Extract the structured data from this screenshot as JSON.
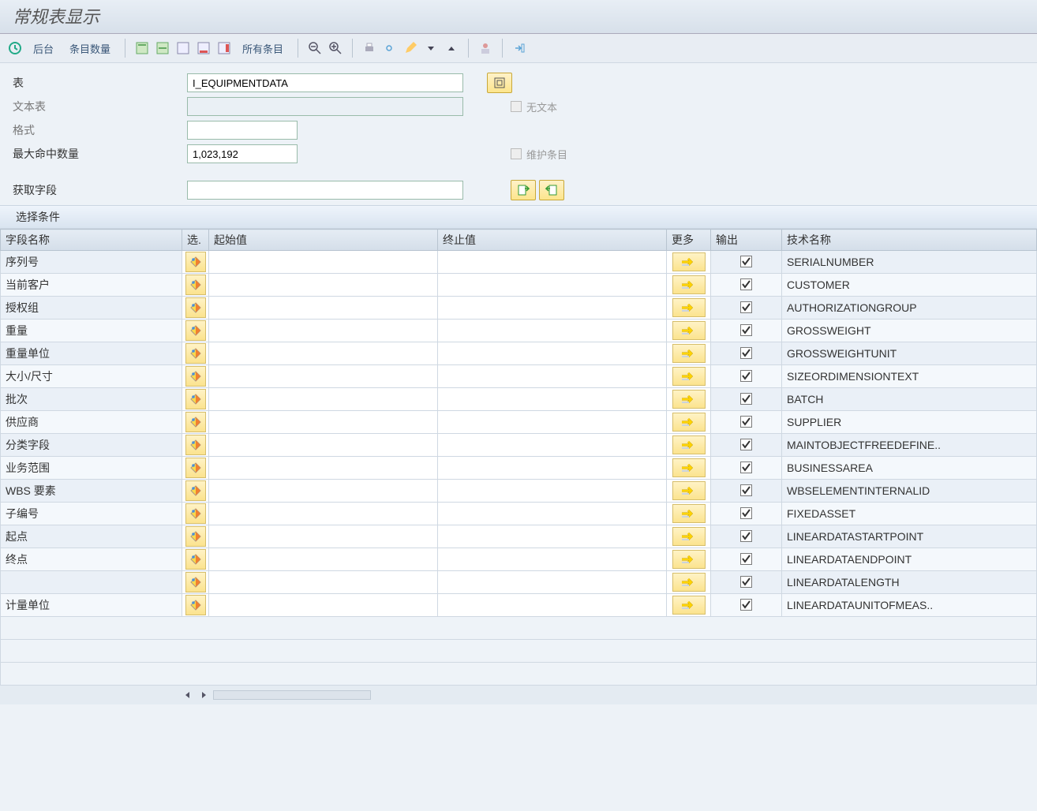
{
  "title": "常规表显示",
  "toolbar": {
    "back_label": "后台",
    "count_label": "条目数量",
    "all_label": "所有条目"
  },
  "form": {
    "table_label": "表",
    "table_value": "I_EQUIPMENTDATA",
    "text_table_label": "文本表",
    "no_text_label": "无文本",
    "format_label": "格式",
    "max_hits_label": "最大命中数量",
    "max_hits_value": "1,023,192",
    "maintain_label": "维护条目",
    "get_fields_label": "获取字段"
  },
  "section": {
    "selection_conditions": "选择条件"
  },
  "columns": {
    "field_name": "字段名称",
    "sel": "选.",
    "start_value": "起始值",
    "end_value": "终止值",
    "more": "更多",
    "output": "输出",
    "tech_name": "技术名称"
  },
  "rows": [
    {
      "label": "序列号",
      "tech": "SERIALNUMBER",
      "output": true
    },
    {
      "label": "当前客户",
      "tech": "CUSTOMER",
      "output": true
    },
    {
      "label": "授权组",
      "tech": "AUTHORIZATIONGROUP",
      "output": true
    },
    {
      "label": "重量",
      "tech": "GROSSWEIGHT",
      "output": true
    },
    {
      "label": "重量单位",
      "tech": "GROSSWEIGHTUNIT",
      "output": true
    },
    {
      "label": "大小/尺寸",
      "tech": "SIZEORDIMENSIONTEXT",
      "output": true
    },
    {
      "label": "批次",
      "tech": "BATCH",
      "output": true
    },
    {
      "label": "供应商",
      "tech": "SUPPLIER",
      "output": true
    },
    {
      "label": "分类字段",
      "tech": "MAINTOBJECTFREEDEFINE..",
      "output": true
    },
    {
      "label": "业务范围",
      "tech": "BUSINESSAREA",
      "output": true
    },
    {
      "label": "WBS 要素",
      "tech": "WBSELEMENTINTERNALID",
      "output": true
    },
    {
      "label": "子编号",
      "tech": "FIXEDASSET",
      "output": true
    },
    {
      "label": "起点",
      "tech": "LINEARDATASTARTPOINT",
      "output": true
    },
    {
      "label": "终点",
      "tech": "LINEARDATAENDPOINT",
      "output": true
    },
    {
      "label": "",
      "tech": "LINEARDATALENGTH",
      "output": true
    },
    {
      "label": "计量单位",
      "tech": "LINEARDATAUNITOFMEAS..",
      "output": true
    }
  ]
}
